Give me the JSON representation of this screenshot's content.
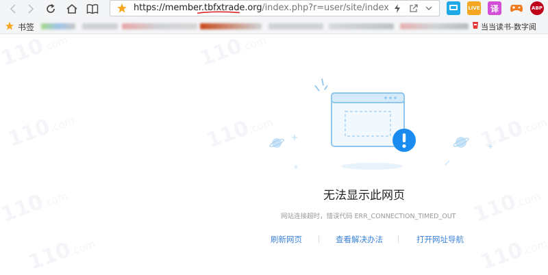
{
  "toolbar": {
    "url_host": "https://member.tbfxtrade.org",
    "url_path": "/index.php?r=user/site/index"
  },
  "bookmarks": {
    "label": "书签",
    "right_item": "当当读书-数字阅"
  },
  "extensions": [
    {
      "name": "live",
      "label": "LIVE",
      "color": "#f5a623"
    },
    {
      "name": "translate",
      "label": "译",
      "color": "#d24fd8"
    },
    {
      "name": "adblock",
      "label": "ABP",
      "color": "#c0001a"
    }
  ],
  "error": {
    "title": "无法显示此网页",
    "detail": "网站连接超时，错误代码 ERR_CONNECTION_TIMED_OUT",
    "actions": [
      "刷新网页",
      "查看解决办法",
      "打开网址导航"
    ]
  },
  "watermark": "110",
  "watermark_suffix": ".com",
  "colors": {
    "accent": "#3a83d6",
    "error_badge": "#1a8cf0",
    "url_underline": "#d9252a"
  }
}
